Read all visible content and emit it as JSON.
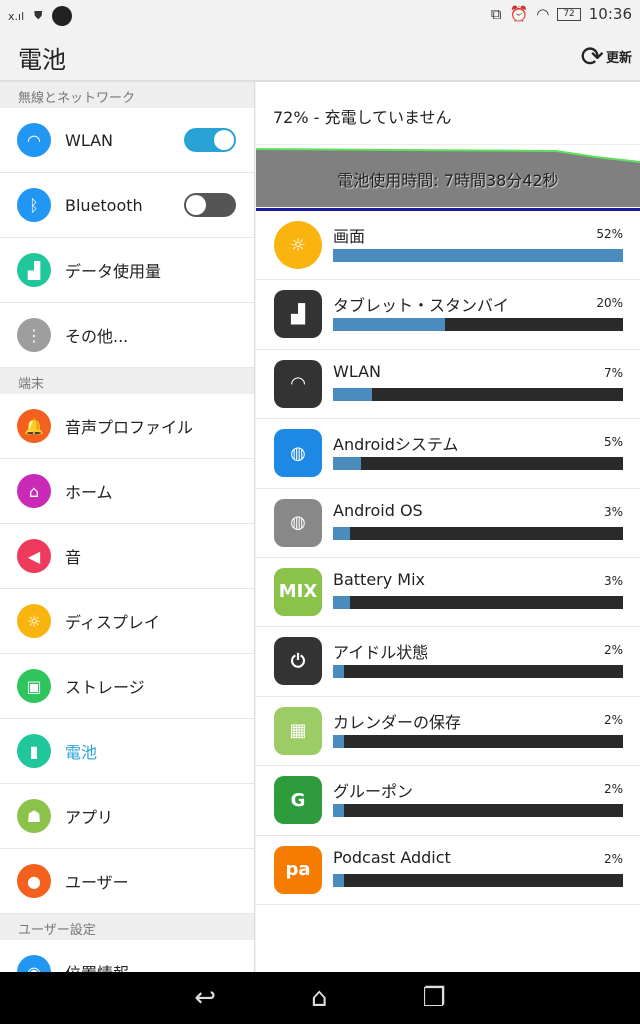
{
  "status": {
    "time": "10:36",
    "battery": "72"
  },
  "appbar": {
    "title": "電池",
    "refresh_label": "更新"
  },
  "sidebar": {
    "sections": [
      {
        "title": "無線とネットワーク",
        "items": [
          {
            "label": "WLAN",
            "icon": "wifi-icon",
            "color": "#2196f3",
            "toggle": true
          },
          {
            "label": "Bluetooth",
            "icon": "bluetooth-icon",
            "color": "#2196f3",
            "toggle": false
          },
          {
            "label": "データ使用量",
            "icon": "data-usage-icon",
            "color": "#1fc79a"
          },
          {
            "label": "その他...",
            "icon": "more-icon",
            "color": "#9e9e9e"
          }
        ]
      },
      {
        "title": "端末",
        "items": [
          {
            "label": "音声プロファイル",
            "icon": "bell-icon",
            "color": "#f4611e"
          },
          {
            "label": "ホーム",
            "icon": "home-icon",
            "color": "#c92ab8"
          },
          {
            "label": "音",
            "icon": "speaker-icon",
            "color": "#ef3a5d"
          },
          {
            "label": "ディスプレイ",
            "icon": "brightness-icon",
            "color": "#f9b40f"
          },
          {
            "label": "ストレージ",
            "icon": "storage-icon",
            "color": "#2fc55e"
          },
          {
            "label": "電池",
            "icon": "battery-icon",
            "color": "#1fc79a",
            "active": true
          },
          {
            "label": "アプリ",
            "icon": "android-icon",
            "color": "#8bc34a"
          },
          {
            "label": "ユーザー",
            "icon": "user-icon",
            "color": "#f4611e"
          }
        ]
      },
      {
        "title": "ユーザー設定",
        "items": [
          {
            "label": "位置情報",
            "icon": "location-icon",
            "color": "#2196f3"
          }
        ]
      }
    ]
  },
  "main": {
    "status_text": "72% - 充電していません",
    "usage_time": "電池使用時間: 7時間38分42秒",
    "apps": [
      {
        "name": "画面",
        "percent": 52,
        "icon": "screen-brightness-icon",
        "color": "#f9b40f"
      },
      {
        "name": "タブレット・スタンバイ",
        "percent": 20,
        "icon": "signal-icon",
        "color": "#333"
      },
      {
        "name": "WLAN",
        "percent": 7,
        "icon": "wifi-icon",
        "color": "#333"
      },
      {
        "name": "Androidシステム",
        "percent": 5,
        "icon": "android-system-icon",
        "color": "#1e88e5"
      },
      {
        "name": "Android OS",
        "percent": 3,
        "icon": "android-os-icon",
        "color": "#888"
      },
      {
        "name": "Battery Mix",
        "percent": 3,
        "icon": "battery-mix-icon",
        "color": "#8bc34a"
      },
      {
        "name": "アイドル状態",
        "percent": 2,
        "icon": "power-icon",
        "color": "#333"
      },
      {
        "name": "カレンダーの保存",
        "percent": 2,
        "icon": "calendar-icon",
        "color": "#9ccc65"
      },
      {
        "name": "グルーポン",
        "percent": 2,
        "icon": "groupon-icon",
        "color": "#2e9b3c"
      },
      {
        "name": "Podcast Addict",
        "percent": 2,
        "icon": "podcast-addict-icon",
        "color": "#f57c00"
      }
    ]
  }
}
